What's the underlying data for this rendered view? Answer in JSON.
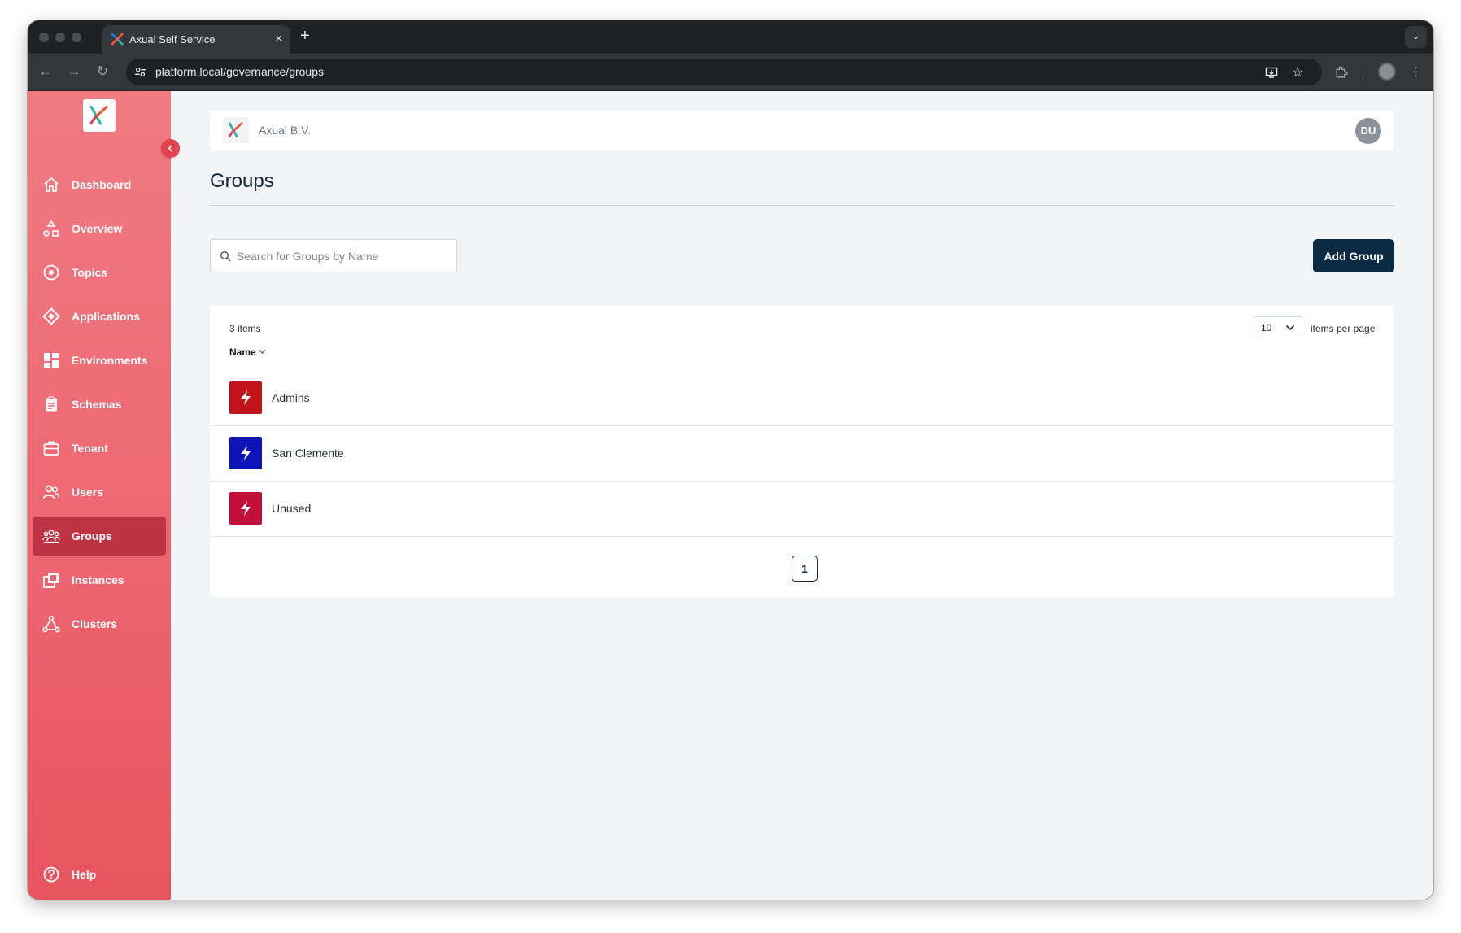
{
  "browser": {
    "tab_title": "Axual Self Service",
    "url": "platform.local/governance/groups",
    "tab_close": "×",
    "new_tab": "+",
    "tab_menu": "⌄"
  },
  "sidebar": {
    "items": [
      {
        "label": "Dashboard",
        "icon": "home-icon"
      },
      {
        "label": "Overview",
        "icon": "overview-icon"
      },
      {
        "label": "Topics",
        "icon": "topics-icon"
      },
      {
        "label": "Applications",
        "icon": "applications-icon"
      },
      {
        "label": "Environments",
        "icon": "environments-icon"
      },
      {
        "label": "Schemas",
        "icon": "schemas-icon"
      },
      {
        "label": "Tenant",
        "icon": "tenant-icon"
      },
      {
        "label": "Users",
        "icon": "users-icon"
      },
      {
        "label": "Groups",
        "icon": "groups-icon",
        "active": true
      },
      {
        "label": "Instances",
        "icon": "instances-icon"
      },
      {
        "label": "Clusters",
        "icon": "clusters-icon"
      }
    ],
    "help": {
      "label": "Help",
      "icon": "help-icon"
    }
  },
  "header": {
    "org_name": "Axual B.V.",
    "user_initials": "DU"
  },
  "page": {
    "title": "Groups",
    "search_placeholder": "Search for Groups by Name",
    "add_button": "Add Group"
  },
  "table": {
    "count_label": "3 items",
    "per_page_value": "10",
    "per_page_label": "items per page",
    "column_name": "Name",
    "rows": [
      {
        "name": "Admins",
        "color": "#c0131b"
      },
      {
        "name": "San Clemente",
        "color": "#0d14b8"
      },
      {
        "name": "Unused",
        "color": "#c3103a"
      }
    ],
    "current_page": "1"
  },
  "colors": {
    "accent": "#0b2a44",
    "sidebar": "#ec6570",
    "sidebar_active": "#bf3444"
  }
}
